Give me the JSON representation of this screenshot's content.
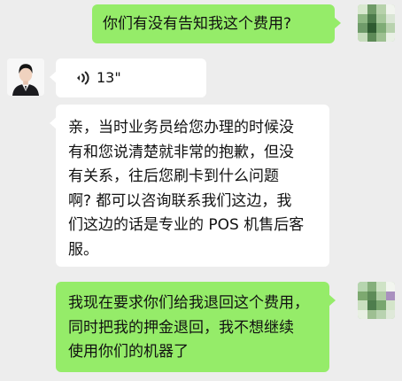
{
  "messages": [
    {
      "side": "right",
      "lines": [
        "你们有没有告知我这个费用?"
      ]
    },
    {
      "side": "left",
      "type": "voice",
      "duration": "13\""
    },
    {
      "side": "left",
      "lines": [
        "亲，当时业务员给您办理的时候没",
        "有和您说清楚就非常的抱歉，但没",
        "有关系，往后您刷卡到什么问题",
        "啊? 都可以咨询联系我们这边，我",
        "们这边的话是专业的 POS 机售后客",
        "服。"
      ]
    },
    {
      "side": "right",
      "lines": [
        "我现在要求你们给我退回这个费用，",
        "同时把我的押金退回，我不想继续",
        "使用你们的机器了"
      ]
    }
  ],
  "icons": {
    "voice": "voice-wave-icon",
    "user_avatar": "pixelated-user-avatar",
    "agent_avatar": "agent-avatar"
  },
  "colors": {
    "background": "#ededed",
    "sent_bubble": "#95ec69",
    "received_bubble": "#ffffff",
    "text": "#111111"
  }
}
